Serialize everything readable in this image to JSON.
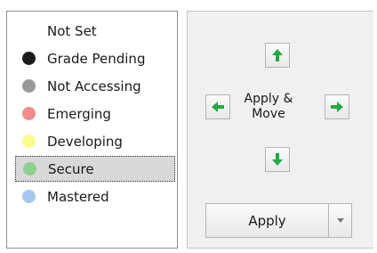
{
  "grades": [
    {
      "label": "Not Set",
      "color": null,
      "selected": false
    },
    {
      "label": "Grade Pending",
      "color": "#1c1c1c",
      "selected": false
    },
    {
      "label": "Not Accessing",
      "color": "#999999",
      "selected": false
    },
    {
      "label": "Emerging",
      "color": "#f08c8c",
      "selected": false
    },
    {
      "label": "Developing",
      "color": "#fbfb8a",
      "selected": false
    },
    {
      "label": "Secure",
      "color": "#8fd08f",
      "selected": true
    },
    {
      "label": "Mastered",
      "color": "#a6c8f0",
      "selected": false
    }
  ],
  "actions": {
    "apply_move_label": "Apply & Move",
    "apply_label": "Apply",
    "arrow_color": "#22aa44",
    "icons": {
      "up": "arrow-up-icon",
      "down": "arrow-down-icon",
      "left": "arrow-left-icon",
      "right": "arrow-right-icon",
      "dropdown": "chevron-down-icon"
    }
  }
}
